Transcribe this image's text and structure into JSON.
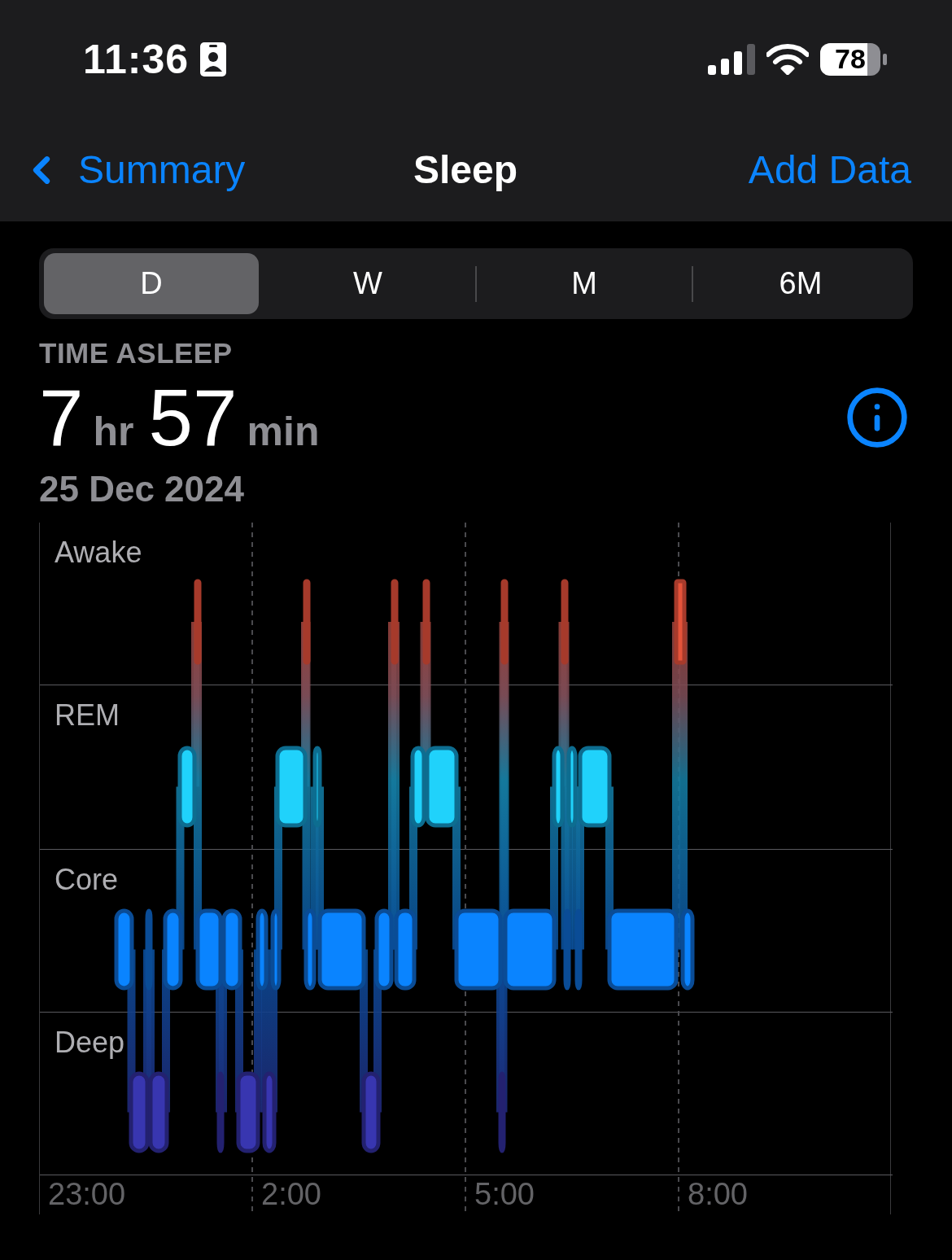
{
  "status_bar": {
    "time": "11:36",
    "battery": "78"
  },
  "nav": {
    "back": "Summary",
    "title": "Sleep",
    "action": "Add Data"
  },
  "ranges": [
    {
      "label": "D",
      "selected": true
    },
    {
      "label": "W",
      "selected": false
    },
    {
      "label": "M",
      "selected": false
    },
    {
      "label": "6M",
      "selected": false
    }
  ],
  "summary": {
    "label": "TIME ASLEEP",
    "hours": "7",
    "hours_unit": "hr",
    "minutes": "57",
    "minutes_unit": "min",
    "date": "25 Dec 2024"
  },
  "chart": {
    "stages": [
      "Awake",
      "REM",
      "Core",
      "Deep"
    ],
    "time_labels": [
      "23:00",
      "2:00",
      "5:00",
      "8:00"
    ]
  }
}
